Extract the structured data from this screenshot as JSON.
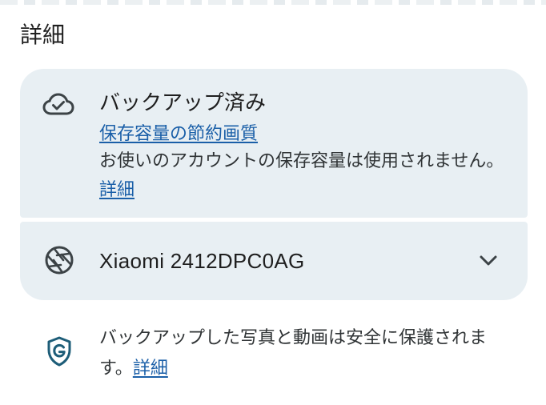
{
  "section": {
    "title": "詳細"
  },
  "backup": {
    "icon": "cloud-done-icon",
    "title": "バックアップ済み",
    "quality_link": "保存容量の節約画質",
    "description": "お使いのアカウントの保存容量は使用されません。",
    "details_link": "詳細"
  },
  "device": {
    "icon": "camera-shutter-icon",
    "name": "Xiaomi 2412DPC0AG",
    "expand_icon": "chevron-down-icon"
  },
  "security": {
    "icon": "shield-g-icon",
    "text": "バックアップした写真と動画は安全に保護されます。",
    "details_link": "詳細"
  },
  "colors": {
    "card_background": "#e8eff3",
    "link": "#1a5fa8",
    "text_primary": "#1f1f1f",
    "text_secondary": "#303436"
  }
}
